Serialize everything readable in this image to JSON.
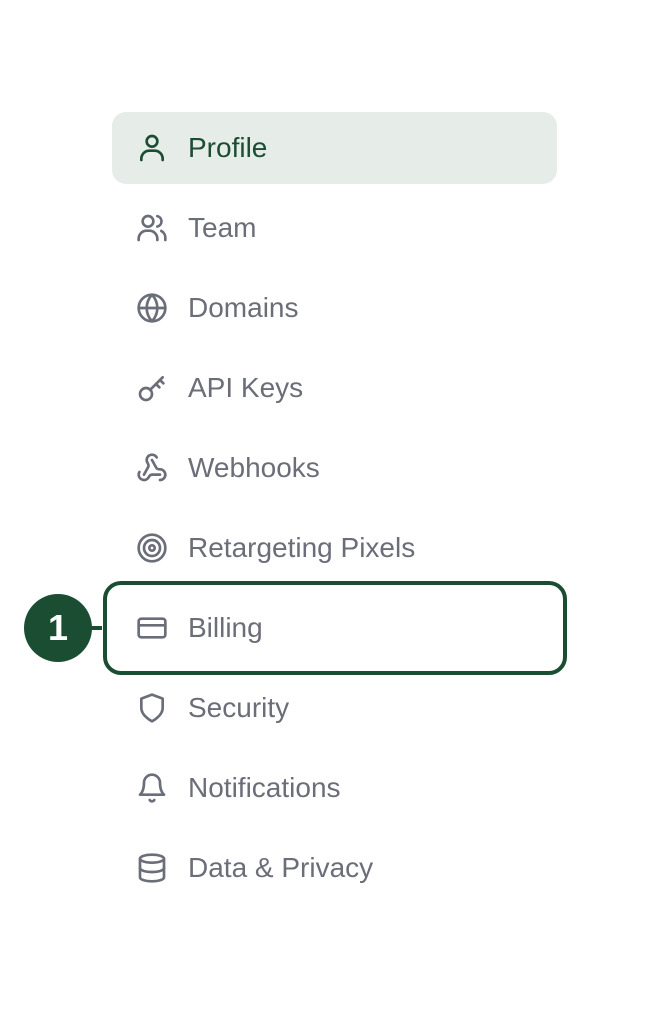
{
  "accent": "#1b4d33",
  "active_bg": "#e6ede8",
  "text_color": "#6b6e78",
  "nav": {
    "items": [
      {
        "label": "Profile",
        "icon": "user-icon",
        "active": true
      },
      {
        "label": "Team",
        "icon": "users-icon"
      },
      {
        "label": "Domains",
        "icon": "globe-icon"
      },
      {
        "label": "API Keys",
        "icon": "key-icon"
      },
      {
        "label": "Webhooks",
        "icon": "webhook-icon"
      },
      {
        "label": "Retargeting Pixels",
        "icon": "target-icon"
      },
      {
        "label": "Billing",
        "icon": "credit-card-icon",
        "highlighted": true
      },
      {
        "label": "Security",
        "icon": "shield-icon"
      },
      {
        "label": "Notifications",
        "icon": "bell-icon"
      },
      {
        "label": "Data & Privacy",
        "icon": "database-icon"
      }
    ]
  },
  "annotation": {
    "number": "1"
  }
}
